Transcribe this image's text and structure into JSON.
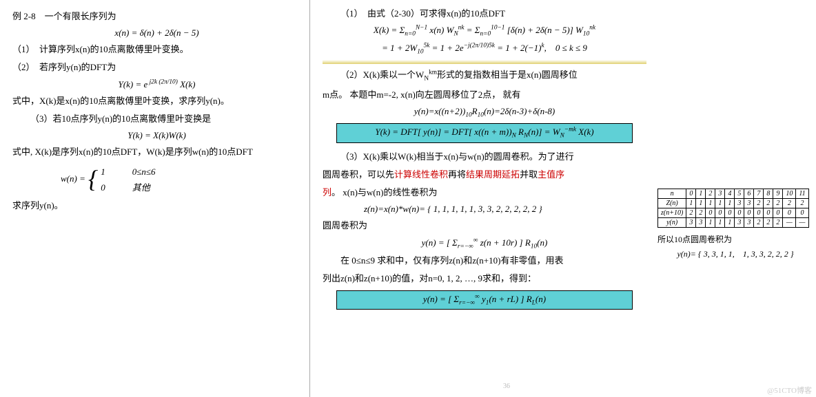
{
  "left": {
    "title": "例 2-8　一个有限长序列为",
    "eq1": "x(n) = δ(n) + 2δ(n − 5)",
    "q1": "（1）　计算序列x(n)的10点离散傅里叶变换。",
    "q2": "（2）　若序列y(n)的DFT为",
    "eq2_html": "Y(k) = e<sup>&nbsp;j2k (2π/10)</sup> X(k)",
    "note1": "式中，X(k)是x(n)的10点离散傅里叶变换，求序列y(n)。",
    "q3": "（3）若10点序列y(n)的10点离散傅里叶变换是",
    "eq3": "Y(k) = X(k)W(k)",
    "note2": "式中, X(k)是序列x(n)的10点DFT，W(k)是序列w(n)的10点DFT",
    "wn_lhs": "w(n) =",
    "wn_row1": "1　　　0≤n≤6",
    "wn_row2": "0　　　其他",
    "ask": "求序列y(n)。"
  },
  "mid": {
    "a1_title": "（1）　由式（2-30）可求得x(n)的10点DFT",
    "a1_eq1_html": "X(k) = Σ<sub>n=0</sub><sup>N−1</sup> x(n) W<sub>N</sub><sup>nk</sup> = Σ<sub>n=0</sub><sup>10−1</sup> [δ(n) + 2δ(n − 5)] W<sub>10</sub><sup>nk</sup>",
    "a1_eq2_html": "= 1 + 2W<sub>10</sub><sup>5k</sup> = 1 + 2e<sup>−j(2π/10)5k</sup> = 1 + 2(−1)<sup>k</sup>,　0 ≤ k ≤ 9",
    "a2_p1_html": "（2）X(k)乘以一个W<sub>N</sub><sup>km</sup>形式的复指数相当于是x(n)圆周移位",
    "a2_p2_html": "m点。 本题中m=-2, x(n)向左圆周移位了2点， 就有",
    "a2_eq1_html": "y(n)=x((n+2))<sub>10</sub>R<sub>10</sub>(n)=2δ(n-3)+δ(n-8)",
    "a2_box_html": "Y(k) = DFT[ y(n)] = DFT[ x((n + m))<sub>N</sub> R<sub>N</sub>(n)] = W<sub>N</sub><sup>−mk</sup> X(k)",
    "a3_p1a": "（3）X(k)乘以W(k)相当于x(n)与w(n)的圆周卷积。为了进行",
    "a3_p1b_pre": "圆周卷积，可以先",
    "a3_p1b_red1": "计算线性卷积",
    "a3_p1b_mid": "再将",
    "a3_p1b_red2": "结果周期延拓",
    "a3_p1b_mid2": "并取",
    "a3_p1b_red3": "主值序",
    "a3_p1c_red": "列",
    "a3_p1c": "。 x(n)与w(n)的线性卷积为",
    "a3_eq1": "z(n)=x(n)*w(n)= { 1, 1, 1, 1, 1, 3, 3, 2, 2, 2, 2, 2 }",
    "a3_label": "圆周卷积为",
    "a3_eq2_html": "y(n) = [ Σ<sub>r=−∞</sub><sup>∞</sup> z(n + 10r) ] R<sub>10</sub>(n)",
    "a3_p2": "在 0≤n≤9 求和中，仅有序列z(n)和z(n+10)有非零值，用表",
    "a3_p3": "列出z(n)和z(n+10)的值，对n=0, 1, 2, …, 9求和，得到：",
    "a3_box_html": "y(n) = [ Σ<sub>r=−∞</sub><sup>∞</sup> y<sub>1</sub>(n + rL) ] R<sub>L</sub>(n)"
  },
  "right": {
    "table": {
      "header_n": "n",
      "cols_a": [
        "0",
        "1",
        "2",
        "3",
        "4",
        "5",
        "6",
        "7",
        "8",
        "9"
      ],
      "cols_b": [
        "10",
        "11"
      ],
      "rows": [
        {
          "label": "Z(n)",
          "a": [
            "1",
            "1",
            "1",
            "1",
            "1",
            "3",
            "3",
            "2",
            "2",
            "2"
          ],
          "b": [
            "2",
            "2"
          ]
        },
        {
          "label": "z(n+10)",
          "a": [
            "2",
            "2",
            "0",
            "0",
            "0",
            "0",
            "0",
            "0",
            "0",
            "0"
          ],
          "b": [
            "0",
            "0"
          ]
        },
        {
          "label": "y(n)",
          "a": [
            "3",
            "3",
            "1",
            "1",
            "1",
            "3",
            "3",
            "2",
            "2",
            "2"
          ],
          "b": [
            "—",
            "—"
          ]
        }
      ]
    },
    "note": "所以10点圆周卷积为",
    "result": "y(n)= { 3, 3, 1, 1,　1, 3, 3, 2, 2, 2 }"
  },
  "footer": {
    "watermark": "@51CTO博客",
    "pagenum": "36"
  }
}
